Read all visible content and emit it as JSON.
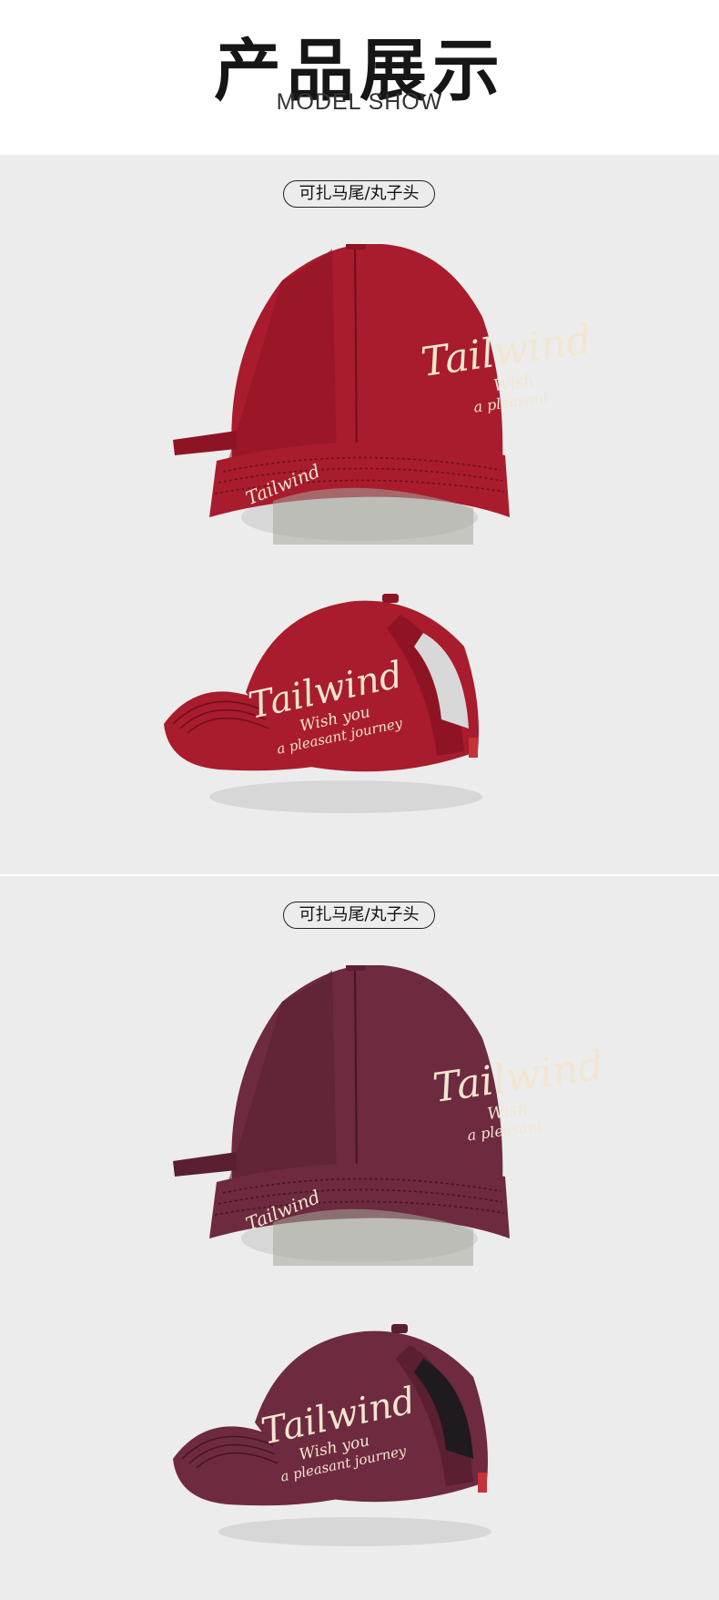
{
  "header": {
    "title": "产品展示",
    "subtitle": "MODEL SHOW"
  },
  "sections": [
    {
      "tag": "可扎马尾/丸子头",
      "color_name": "wine-red",
      "cap_color": "#a81c2d",
      "cap_shade": "#8e1424",
      "embroidery": {
        "front_main": "Tailwind",
        "front_sub1": "Wish",
        "front_sub2": "a pleasant",
        "brim": "Tailwind",
        "side_main": "Tailwind",
        "side_sub1": "Wish you",
        "side_sub2": "a pleasant journey"
      }
    },
    {
      "tag": "可扎马尾/丸子头",
      "color_name": "purple",
      "cap_color": "#6e2a3e",
      "cap_shade": "#5a1f31",
      "embroidery": {
        "front_main": "Tailwind",
        "front_sub1": "Wish",
        "front_sub2": "a pleasant",
        "brim": "Tailwind",
        "side_main": "Tailwind",
        "side_sub1": "Wish you",
        "side_sub2": "a pleasant journey"
      }
    }
  ],
  "embroidery_color": "#f1e6cf"
}
